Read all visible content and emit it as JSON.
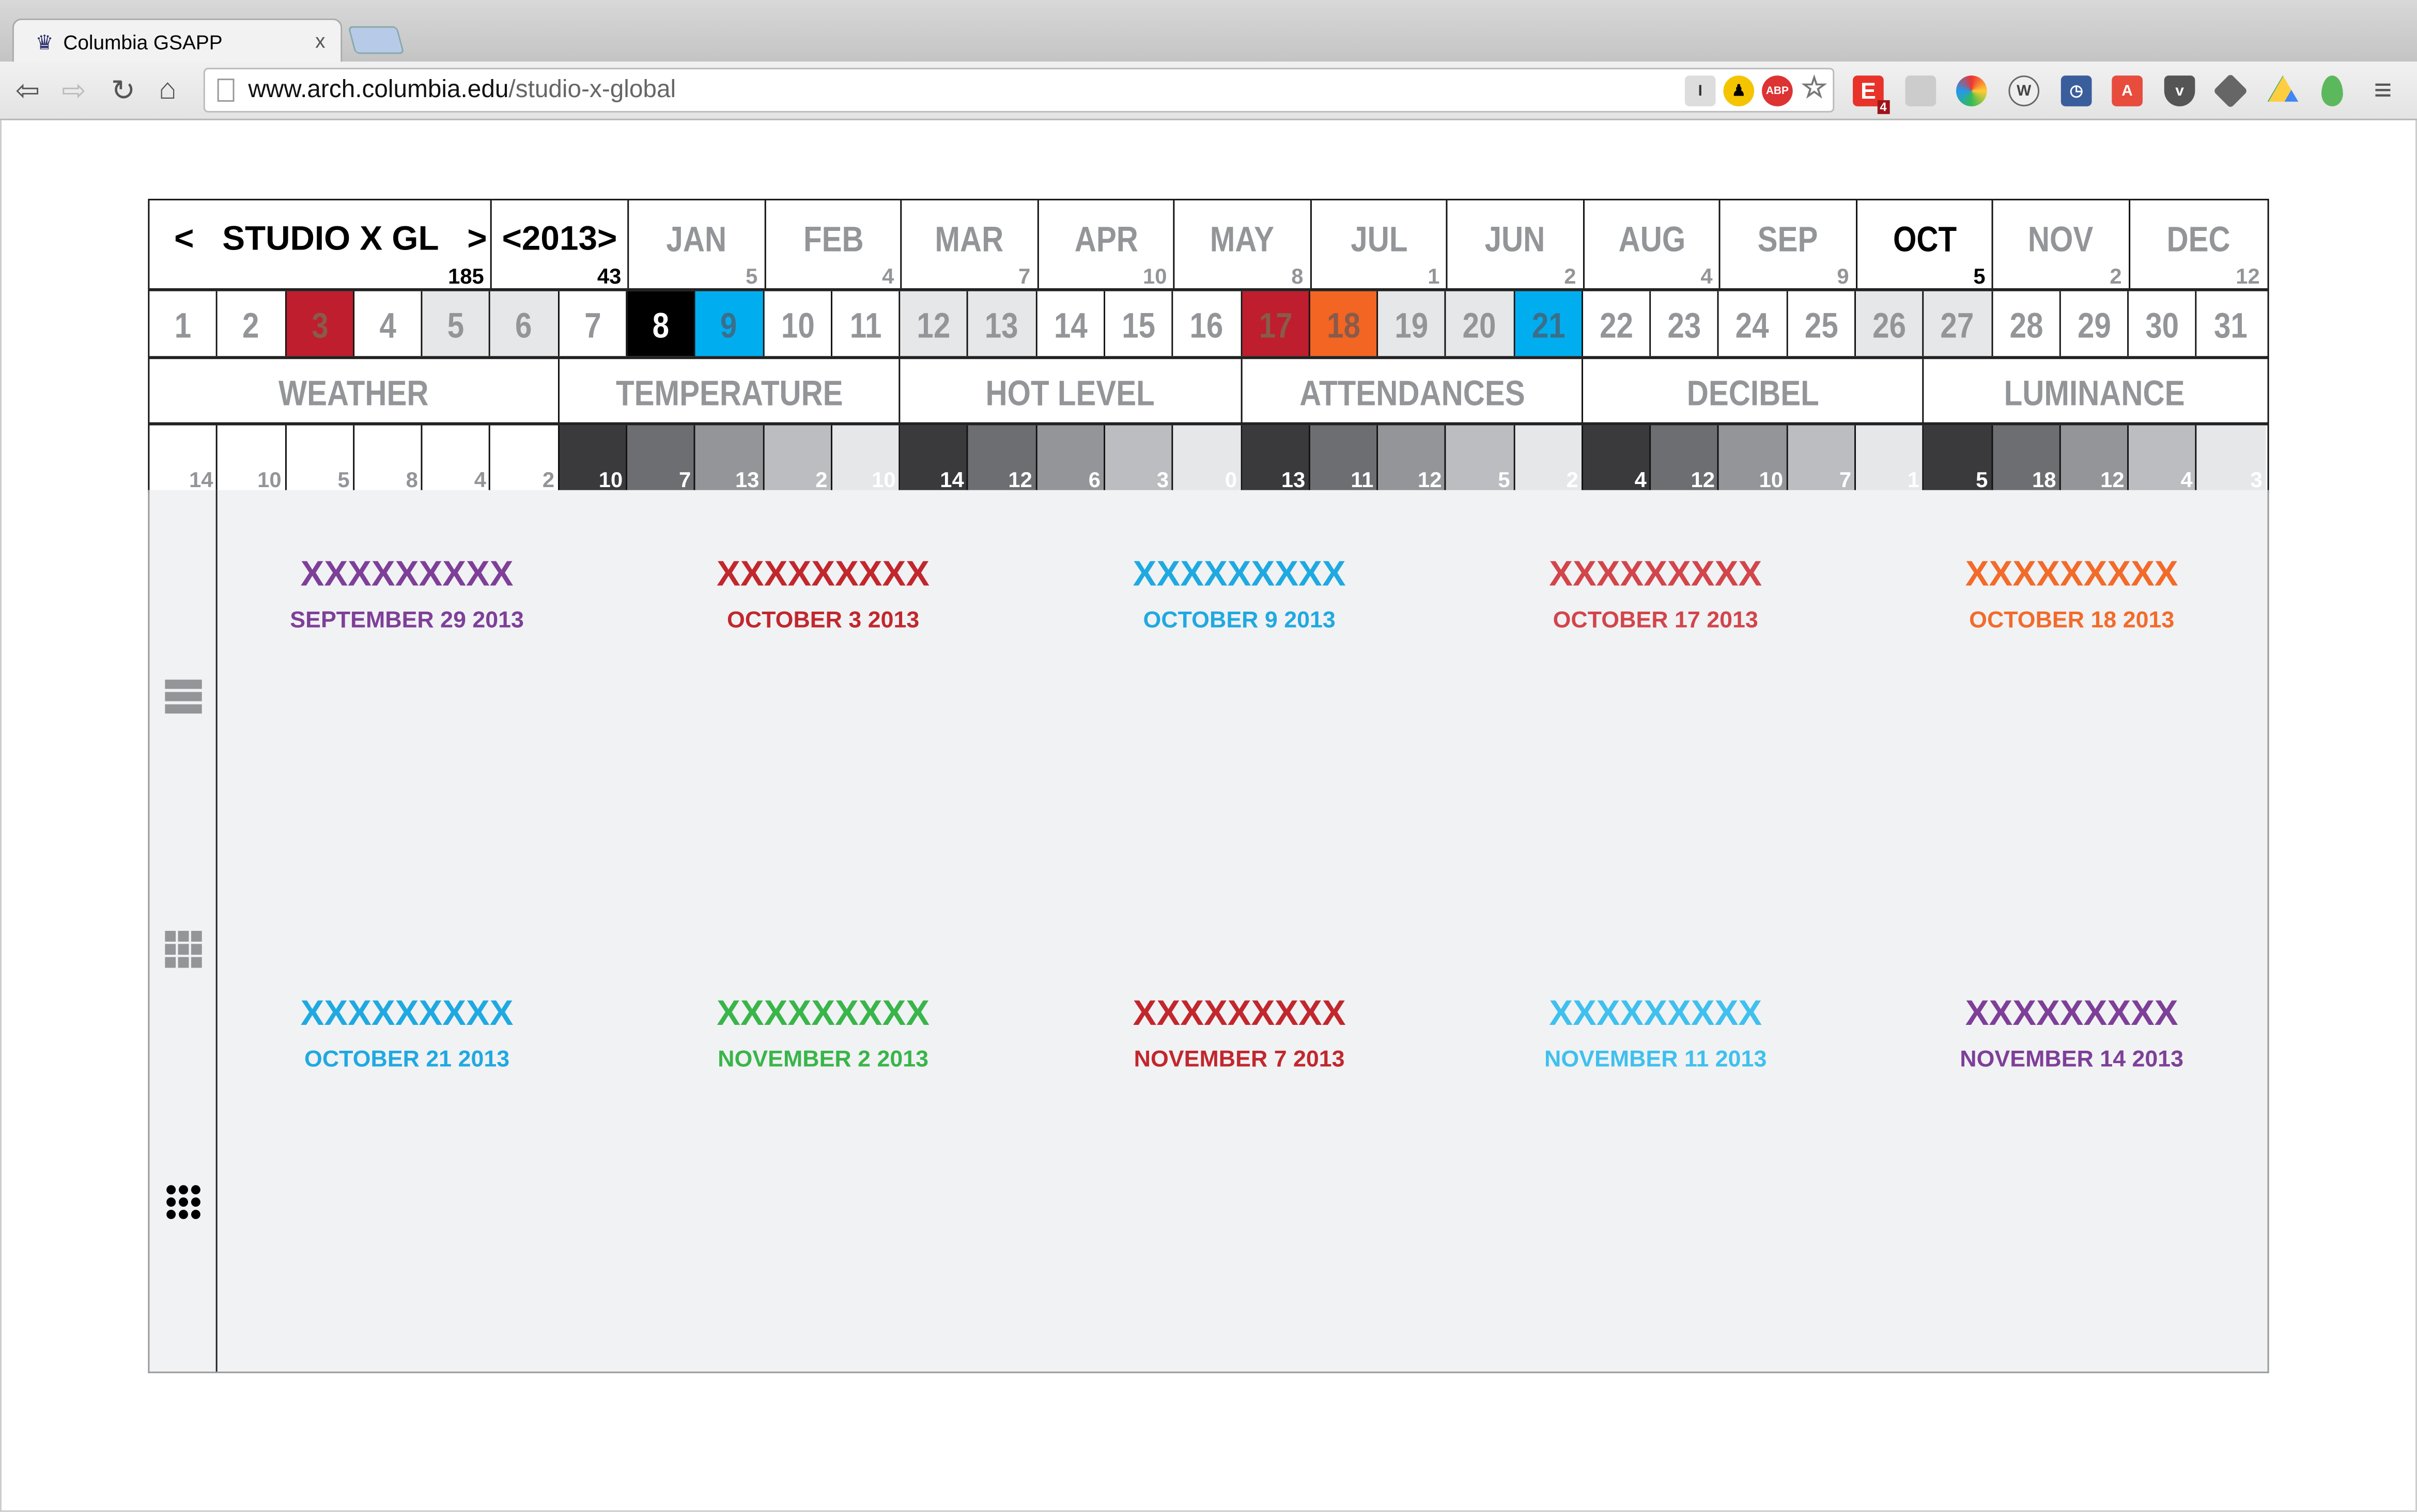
{
  "browser": {
    "tab_title": "Columbia GSAPP",
    "tab_close": "x",
    "url_host": "www.arch.columbia.edu",
    "url_path": "/studio-x-global",
    "ext_badge": "4",
    "icons": [
      "back-icon",
      "forward-icon",
      "reload-icon",
      "home-icon",
      "page-icon",
      "star-icon",
      "menu-icon"
    ]
  },
  "header": {
    "title": "STUDIO X GL",
    "prev": "<",
    "next": ">",
    "title_count": "185",
    "year": "2013",
    "year_count": "43"
  },
  "months": [
    {
      "label": "JAN",
      "count": "5"
    },
    {
      "label": "FEB",
      "count": "4"
    },
    {
      "label": "MAR",
      "count": "7"
    },
    {
      "label": "APR",
      "count": "10"
    },
    {
      "label": "MAY",
      "count": "8"
    },
    {
      "label": "JUL",
      "count": "1"
    },
    {
      "label": "JUN",
      "count": "2"
    },
    {
      "label": "AUG",
      "count": "4"
    },
    {
      "label": "SEP",
      "count": "9"
    },
    {
      "label": "OCT",
      "count": "5",
      "active": true
    },
    {
      "label": "NOV",
      "count": "2"
    },
    {
      "label": "DEC",
      "count": "12"
    }
  ],
  "days": [
    "1",
    "2",
    "3",
    "4",
    "5",
    "6",
    "7",
    "8",
    "9",
    "10",
    "11",
    "12",
    "13",
    "14",
    "15",
    "16",
    "17",
    "18",
    "19",
    "20",
    "21",
    "22",
    "23",
    "24",
    "25",
    "26",
    "27",
    "28",
    "29",
    "30",
    "31"
  ],
  "day_highlights": {
    "3": "#BE1E2D",
    "5": "#E6E7E8",
    "6": "#E6E7E8",
    "8": "#000000",
    "9": "#00AEEF",
    "12": "#E6E7E8",
    "13": "#E6E7E8",
    "17": "#BE1E2D",
    "18": "#F26522",
    "19": "#E6E7E8",
    "20": "#E6E7E8",
    "21": "#00AEEF",
    "26": "#E6E7E8",
    "27": "#E6E7E8"
  },
  "categories": [
    "WEATHER",
    "TEMPERATURE",
    "HOT LEVEL",
    "ATTENDANCES",
    "DECIBEL",
    "LUMINANCE"
  ],
  "weather": [
    {
      "icon": "sun-icon",
      "value": "14"
    },
    {
      "icon": "partly-cloudy-icon",
      "value": "10"
    },
    {
      "icon": "cloud-icon",
      "value": "5"
    },
    {
      "icon": "rain-icon",
      "value": "8"
    },
    {
      "icon": "storm-icon",
      "value": "4"
    },
    {
      "icon": "snow-icon",
      "value": "2"
    }
  ],
  "shades": [
    "#3A3A3C",
    "#6D6E71",
    "#939598",
    "#BCBDC0",
    "#E6E7E8"
  ],
  "metrics": [
    [
      "10",
      "7",
      "13",
      "2",
      "10"
    ],
    [
      "14",
      "12",
      "6",
      "3",
      "0"
    ],
    [
      "13",
      "11",
      "12",
      "5",
      "2"
    ],
    [
      "4",
      "12",
      "10",
      "7",
      "1"
    ],
    [
      "5",
      "18",
      "12",
      "4",
      "3"
    ]
  ],
  "view_icons": [
    "list-view-icon",
    "grid-view-icon",
    "dense-grid-view-icon"
  ],
  "events": [
    {
      "title": "XXXXXXXXX",
      "date": "SEPTEMBER 29 2013",
      "color": "#7E3F98",
      "text": "#7E3F98",
      "x": "#662D91"
    },
    {
      "title": "XXXXXXXXX",
      "date": "OCTOBER 3 2013",
      "color": "#C1272D",
      "text": "#C1272D",
      "x": "#C1272D"
    },
    {
      "title": "XXXXXXXXX",
      "date": "OCTOBER 9 2013",
      "color": "#29B6EE",
      "text": "#1FA9E1",
      "x": "#2AA3DE"
    },
    {
      "title": "XXXXXXXXX",
      "date": "OCTOBER 17 2013",
      "color": "#C1272D",
      "text": "#D2454B",
      "x": "#C1272D"
    },
    {
      "title": "XXXXXXXXX",
      "date": "OCTOBER 18 2013",
      "color": "#F26B2A",
      "text": "#F26B2A",
      "x": "#F26B2A"
    },
    {
      "title": "XXXXXXXXX",
      "date": "OCTOBER 21 2013",
      "color": "#29B6EE",
      "text": "#1FA9E1",
      "x": "#2AA3DE"
    },
    {
      "title": "XXXXXXXXX",
      "date": "NOVEMBER 2 2013",
      "color": "#39B54A",
      "text": "#39B54A",
      "x": "#39B54A"
    },
    {
      "title": "XXXXXXXXX",
      "date": "NOVEMBER 7 2013",
      "color": "#C1272D",
      "text": "#C1272D",
      "x": "#C1272D"
    },
    {
      "title": "XXXXXXXXX",
      "date": "NOVEMBER 11 2013",
      "color": "#29B6EE",
      "text": "#3FC0EE",
      "x": "#2AA3DE"
    },
    {
      "title": "XXXXXXXXX",
      "date": "NOVEMBER 14 2013",
      "color": "#7E3F98",
      "text": "#7E3F98",
      "x": "#662D91"
    }
  ]
}
